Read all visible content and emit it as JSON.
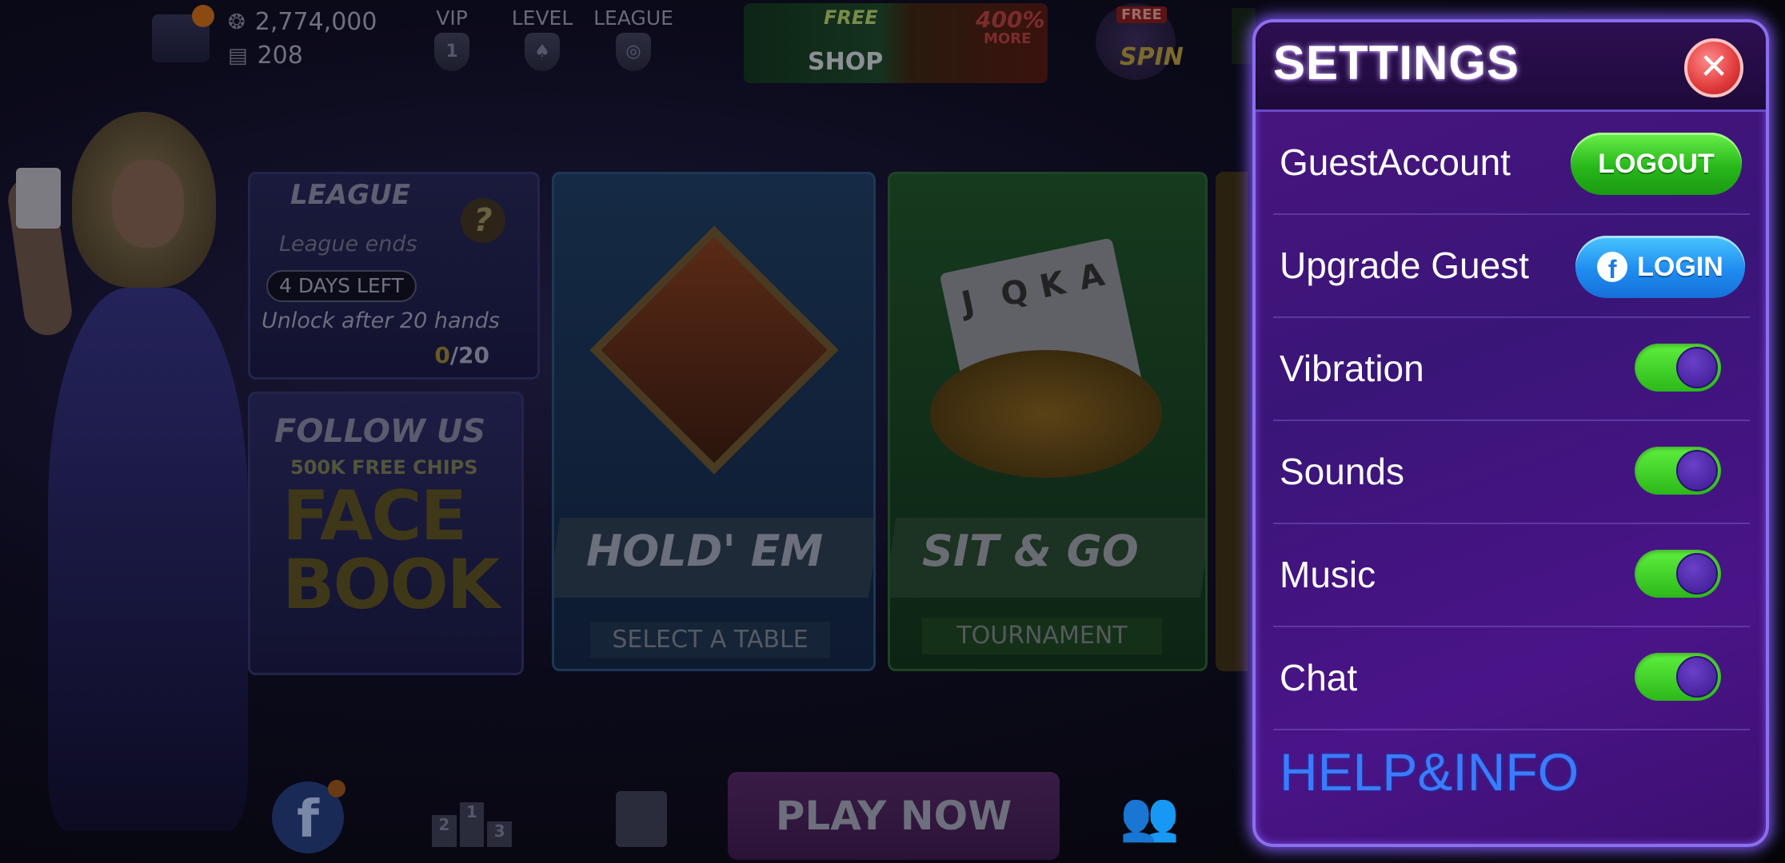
{
  "header": {
    "chips": "2,774,000",
    "tickets": "208",
    "vip_label": "VIP",
    "level_label": "LEVEL",
    "league_label": "LEAGUE",
    "shop_free": "FREE",
    "shop_label": "SHOP",
    "bonus_pct": "400%",
    "bonus_more": "MORE",
    "spin_free": "FREE",
    "spin_label": "SPIN"
  },
  "league_card": {
    "title": "LEAGUE",
    "ends_text": "League ends",
    "days_left": "4 DAYS LEFT",
    "unlock_text": "Unlock after 20 hands",
    "progress_current": "0",
    "progress_total": "/20"
  },
  "follow_card": {
    "title": "FOLLOW US",
    "subtitle": "500K FREE CHIPS",
    "brand": "FACE BOOK"
  },
  "game_modes": [
    {
      "label": "HOLD' EM",
      "sub": "SELECT A TABLE"
    },
    {
      "label": "SIT & GO",
      "sub": "TOURNAMENT"
    }
  ],
  "bottom": {
    "play_now": "PLAY NOW",
    "rank_digits": [
      "2",
      "1",
      "3"
    ]
  },
  "settings": {
    "title": "SETTINGS",
    "close_glyph": "✕",
    "account_label": "GuestAccount",
    "logout_label": "LOGOUT",
    "upgrade_label": "Upgrade Guest",
    "login_label": "LOGIN",
    "toggles": [
      {
        "label": "Vibration",
        "on": true
      },
      {
        "label": "Sounds",
        "on": true
      },
      {
        "label": "Music",
        "on": true
      },
      {
        "label": "Chat",
        "on": true
      }
    ],
    "help_label": "HELP&INFO"
  },
  "icons": {
    "close": "close-icon",
    "facebook": "facebook-icon",
    "chips": "chips-icon",
    "ticket": "ticket-icon"
  },
  "colors": {
    "panel_bg": "#3a1578",
    "panel_border": "#8a6ff0",
    "toggle_on": "#2cb81a",
    "logout_green": "#27b81a",
    "login_blue": "#1f8cf0",
    "close_red": "#e03a3a",
    "help_blue": "#3a7cff"
  }
}
